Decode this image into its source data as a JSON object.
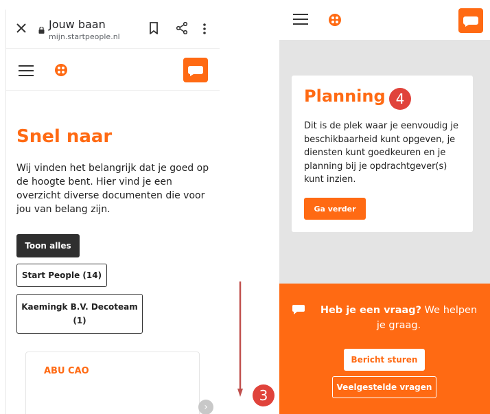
{
  "browser": {
    "page_title": "Jouw baan",
    "url": "mijn.startpeople.nl"
  },
  "left": {
    "heading": "Snel naar",
    "intro": "Wij vinden het belangrijk dat je goed op de hoogte bent. Hier vind je een overzicht diverse documenten die voor jou van belang zijn.",
    "filters": [
      {
        "label": "Toon alles",
        "active": true
      },
      {
        "label": "Start People (14)",
        "active": false
      },
      {
        "label_line1": "Kaemingk B.V. Decoteam",
        "label_line2": "(1)",
        "active": false
      }
    ],
    "card_title": "ABU CAO"
  },
  "markers": {
    "left_marker": "3",
    "right_marker": "4"
  },
  "right": {
    "planning": {
      "title": "Planning",
      "text": "Dit is de plek waar je eenvoudig je beschikbaarheid kunt opgeven, je diensten kunt goedkeuren en je planning bij je opdrachtgever(s) kunt inzien.",
      "button": "Ga verder"
    },
    "help": {
      "question_bold": "Heb je een vraag?",
      "question_rest": " We helpen je graag.",
      "primary_button": "Bericht sturen",
      "secondary_button": "Veelgestelde vragen"
    }
  },
  "colors": {
    "accent": "#ff6a13",
    "marker": "#e0433b",
    "dark_button": "#2f2f2f",
    "background_gray": "#e4e4e4"
  },
  "icons": [
    "close-icon",
    "lock-icon",
    "bookmark-icon",
    "share-icon",
    "more-vert-icon",
    "hamburger-icon",
    "logo-icon",
    "chat-icon",
    "chevron-right-icon",
    "arrow-down-icon"
  ]
}
